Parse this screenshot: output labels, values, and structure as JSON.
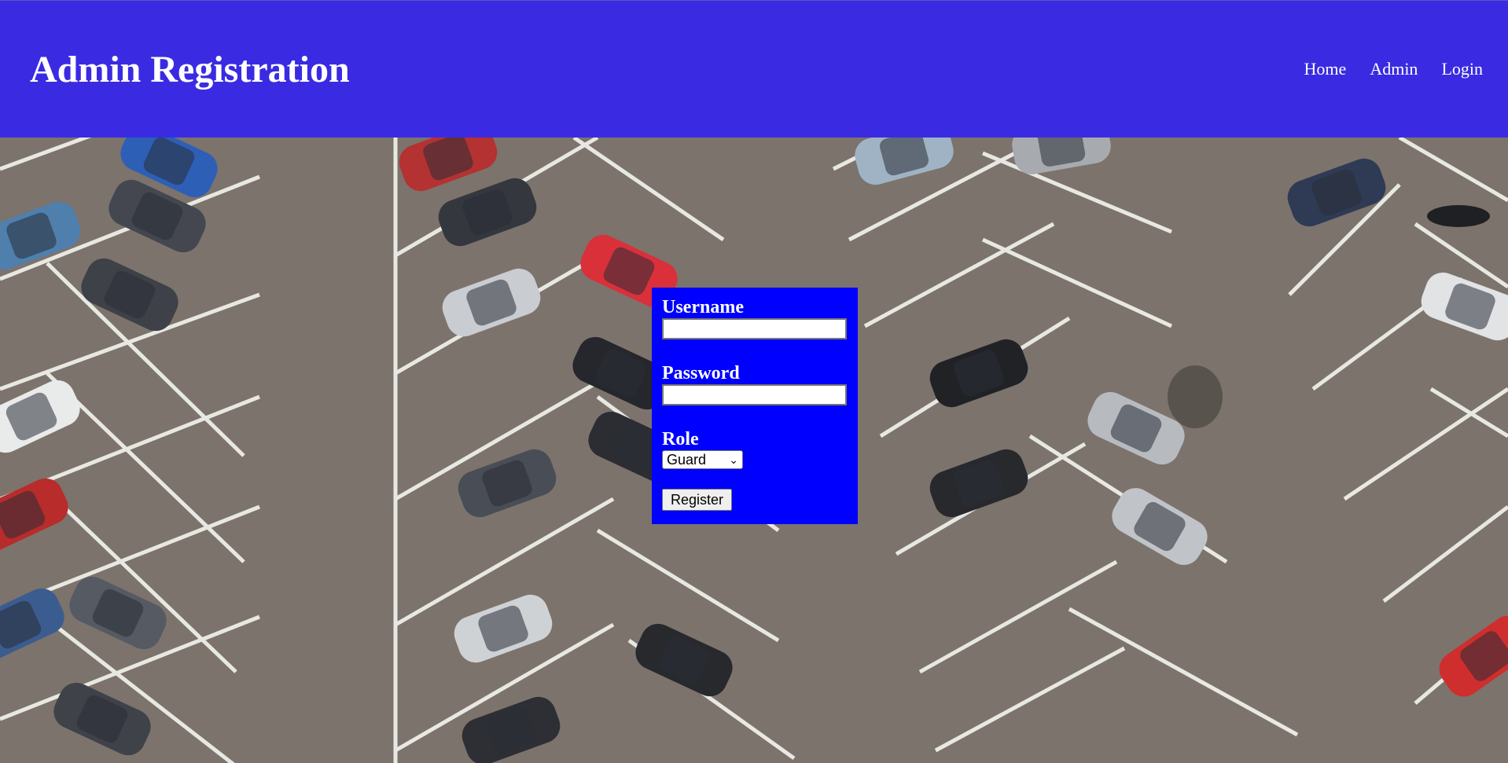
{
  "header": {
    "title": "Admin Registration",
    "nav": [
      "Home",
      "Admin",
      "Login"
    ],
    "color": "#3a2be2"
  },
  "form": {
    "username_label": "Username",
    "username_value": "",
    "password_label": "Password",
    "password_value": "",
    "role_label": "Role",
    "role_selected": "Guard",
    "submit_label": "Register",
    "color": "#0000ff"
  },
  "background": {
    "description_icon": "parking-lot-photo"
  }
}
